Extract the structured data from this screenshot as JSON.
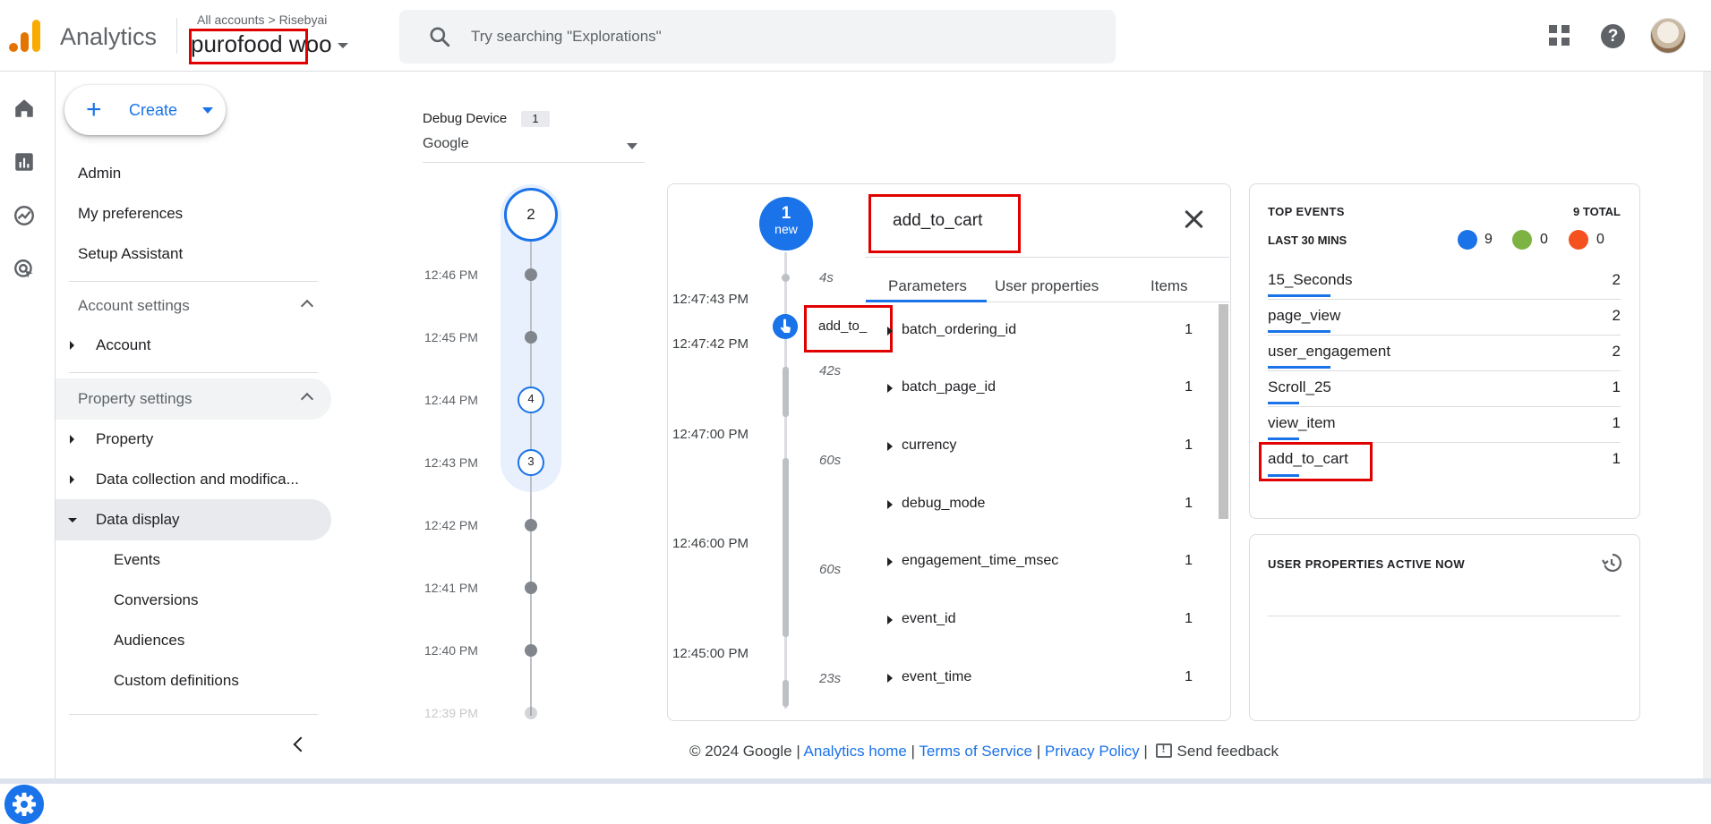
{
  "app": {
    "name": "Analytics"
  },
  "header": {
    "breadcrumb_root": "All accounts",
    "breadcrumb_sep": ">",
    "breadcrumb_account": "Risebyai",
    "property_highlight": "purofood",
    "property_rest": "woo",
    "search_placeholder": "Try searching \"Explorations\""
  },
  "nav": {
    "create_label": "Create",
    "admin": "Admin",
    "my_preferences": "My preferences",
    "setup_assistant": "Setup Assistant",
    "account_settings": "Account settings",
    "account": "Account",
    "property_settings": "Property settings",
    "property": "Property",
    "data_collection": "Data collection and modifica...",
    "data_display": "Data display",
    "events": "Events",
    "conversions": "Conversions",
    "audiences": "Audiences",
    "custom_definitions": "Custom definitions"
  },
  "debug": {
    "device_label": "Debug Device",
    "device_count": "1",
    "device_selected": "Google"
  },
  "minutes_timeline": {
    "top_count": "2",
    "times": [
      "12:46 PM",
      "12:45 PM",
      "12:44 PM",
      "12:43 PM",
      "12:42 PM",
      "12:41 PM",
      "12:40 PM",
      "12:39 PM"
    ],
    "badges": {
      "12:44 PM": "4",
      "12:43 PM": "3"
    }
  },
  "seconds_stream": {
    "new_count": "1",
    "new_label": "new",
    "times": [
      "12:47:43 PM",
      "12:47:42 PM",
      "12:47:00 PM",
      "12:46:00 PM",
      "12:45:00 PM"
    ],
    "durations": [
      "4s",
      "42s",
      "60s",
      "60s",
      "23s"
    ],
    "event_label": "add_to_"
  },
  "event_panel": {
    "title": "add_to_cart",
    "tabs": [
      "Parameters",
      "User properties",
      "Items"
    ],
    "params": [
      {
        "name": "batch_ordering_id",
        "count": "1"
      },
      {
        "name": "batch_page_id",
        "count": "1"
      },
      {
        "name": "currency",
        "count": "1"
      },
      {
        "name": "debug_mode",
        "count": "1"
      },
      {
        "name": "engagement_time_msec",
        "count": "1"
      },
      {
        "name": "event_id",
        "count": "1"
      },
      {
        "name": "event_time",
        "count": "1"
      }
    ]
  },
  "top_events": {
    "title": "TOP EVENTS",
    "total": "9 TOTAL",
    "period": "LAST 30 MINS",
    "count_events": "9",
    "count_conversions": "0",
    "count_errors": "0",
    "rows": [
      {
        "name": "15_Seconds",
        "count": "2",
        "share": 0.22
      },
      {
        "name": "page_view",
        "count": "2",
        "share": 0.22
      },
      {
        "name": "user_engagement",
        "count": "2",
        "share": 0.22
      },
      {
        "name": "Scroll_25",
        "count": "1",
        "share": 0.11
      },
      {
        "name": "view_item",
        "count": "1",
        "share": 0.11
      },
      {
        "name": "add_to_cart",
        "count": "1",
        "share": 0.11
      }
    ]
  },
  "user_properties": {
    "title": "USER PROPERTIES ACTIVE NOW"
  },
  "footer": {
    "copyright": "© 2024 Google |",
    "analytics_home": "Analytics home",
    "terms": "Terms of Service",
    "privacy": "Privacy Policy",
    "send_feedback": "Send feedback"
  },
  "colors": {
    "accent": "#1a73e8",
    "highlight_box": "#e00000",
    "conversion": "#7cb342",
    "error": "#f4511e"
  }
}
